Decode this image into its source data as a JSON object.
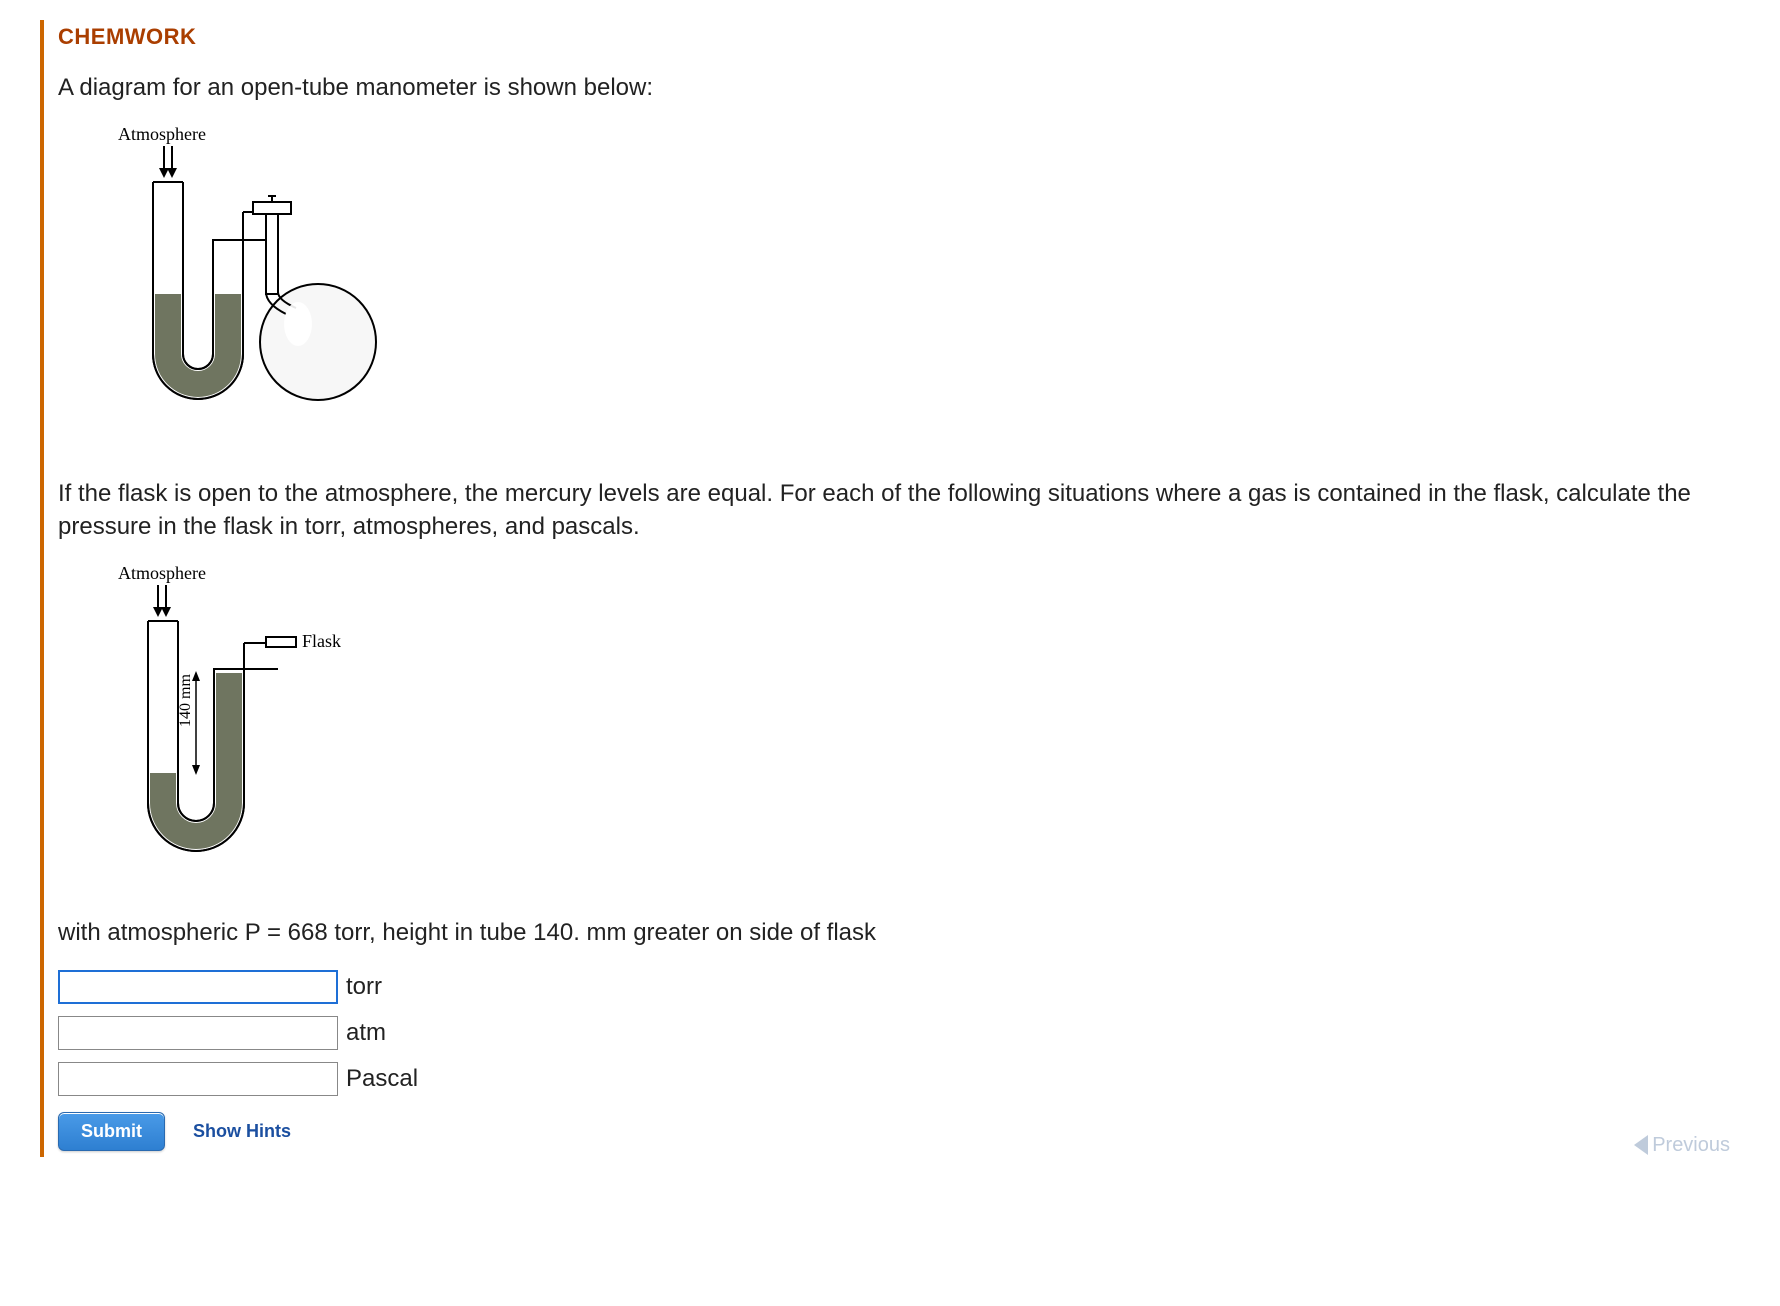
{
  "header": {
    "title": "CHEMWORK"
  },
  "intro": "A diagram for an open-tube manometer is shown below:",
  "diagram1": {
    "atmosphere_label": "Atmosphere"
  },
  "instructions": "If the flask is open to the atmosphere, the mercury levels are equal. For each of the following situations where a gas is contained in the flask, calculate the pressure in the flask in torr, atmospheres, and pascals.",
  "diagram2": {
    "atmosphere_label": "Atmosphere",
    "flask_label": "Flask",
    "height_label": "140 mm"
  },
  "condition": "with atmospheric P = 668 torr, height in tube 140. mm greater on side of flask",
  "answers": {
    "rows": [
      {
        "value": "",
        "unit": "torr",
        "focused": true
      },
      {
        "value": "",
        "unit": "atm",
        "focused": false
      },
      {
        "value": "",
        "unit": "Pascal",
        "focused": false
      }
    ]
  },
  "buttons": {
    "submit": "Submit",
    "show_hints": "Show Hints",
    "previous": "Previous"
  }
}
